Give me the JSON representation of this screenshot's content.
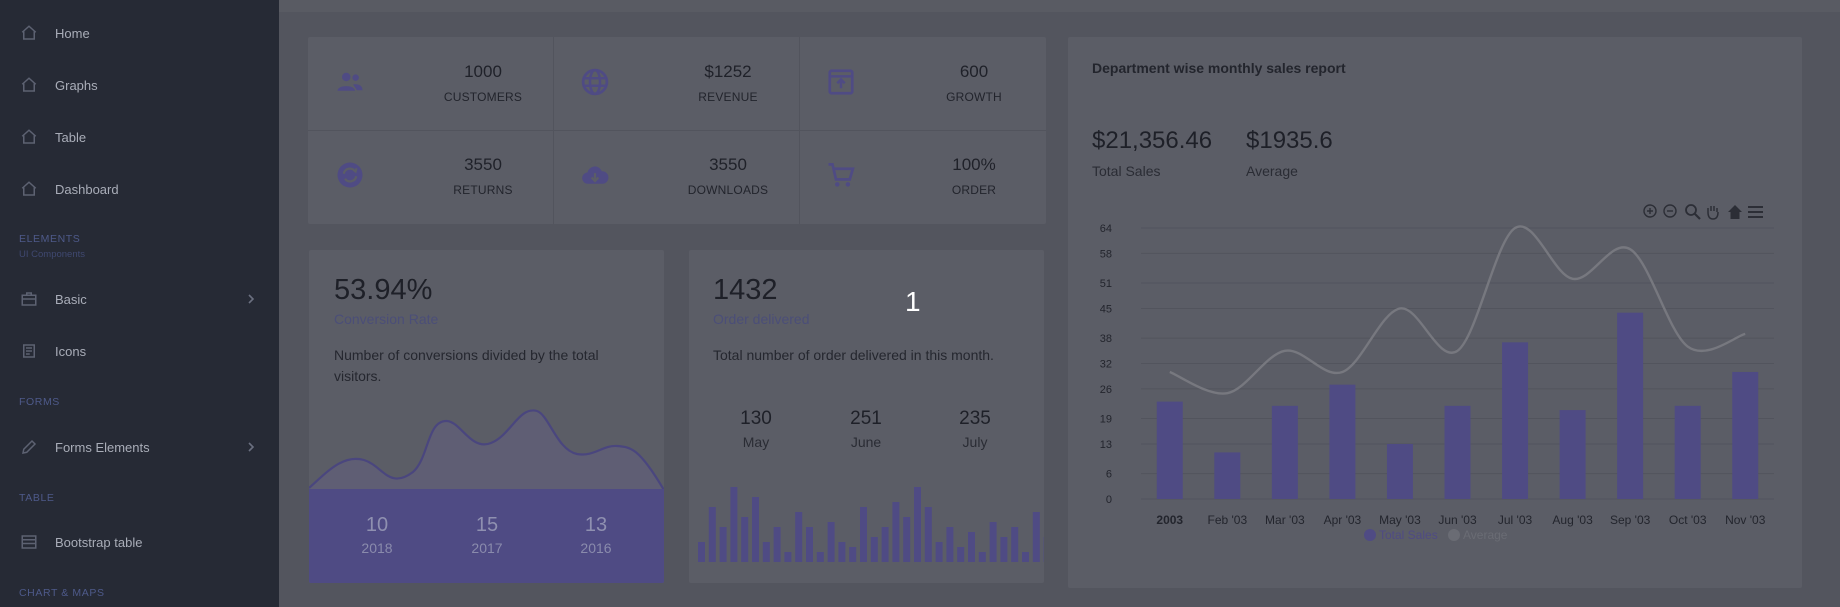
{
  "sidebar": {
    "items": [
      {
        "label": "Home",
        "icon": "home-icon"
      },
      {
        "label": "Graphs",
        "icon": "home-icon"
      },
      {
        "label": "Table",
        "icon": "home-icon"
      },
      {
        "label": "Dashboard",
        "icon": "home-icon"
      }
    ],
    "elements_section": "ELEMENTS",
    "elements_sub": "UI Components",
    "elements_items": [
      {
        "label": "Basic",
        "icon": "briefcase-icon"
      },
      {
        "label": "Icons",
        "icon": "gem-icon"
      }
    ],
    "forms_section": "FORMS",
    "forms_items": [
      {
        "label": "Forms Elements",
        "icon": "pencil-icon"
      }
    ],
    "table_section": "TABLE",
    "table_items": [
      {
        "label": "Bootstrap table",
        "icon": "table-icon"
      }
    ],
    "charts_section": "CHART & MAPS"
  },
  "stats": [
    {
      "value": "1000",
      "label": "CUSTOMERS",
      "icon": "users-icon"
    },
    {
      "value": "$1252",
      "label": "REVENUE",
      "icon": "globe-icon"
    },
    {
      "value": "600",
      "label": "GROWTH",
      "icon": "archive-icon"
    },
    {
      "value": "3550",
      "label": "RETURNS",
      "icon": "sync-icon"
    },
    {
      "value": "3550",
      "label": "DOWNLOADS",
      "icon": "cloud-download-icon"
    },
    {
      "value": "100%",
      "label": "ORDER",
      "icon": "cart-icon"
    }
  ],
  "conversion": {
    "value": "53.94%",
    "label": "Conversion Rate",
    "description": "Number of conversions divided by the total visitors.",
    "years": [
      {
        "value": "10",
        "year": "2018"
      },
      {
        "value": "15",
        "year": "2017"
      },
      {
        "value": "13",
        "year": "2016"
      }
    ]
  },
  "orders": {
    "value": "1432",
    "label": "Order delivered",
    "description": "Total number of order delivered in this month.",
    "months": [
      {
        "value": "130",
        "month": "May"
      },
      {
        "value": "251",
        "month": "June"
      },
      {
        "value": "235",
        "month": "July"
      }
    ],
    "bars": [
      4,
      11,
      7,
      15,
      9,
      13,
      4,
      7,
      2,
      10,
      7,
      2,
      8,
      4,
      3,
      11,
      5,
      7,
      12,
      9,
      15,
      11,
      4,
      7,
      3,
      6,
      2,
      8,
      5,
      7,
      2,
      10,
      5,
      2,
      9,
      5,
      5,
      14
    ]
  },
  "report": {
    "title": "Department wise monthly sales report",
    "total_sales_value": "$21,356.46",
    "total_sales_label": "Total Sales",
    "average_value": "$1935.6",
    "average_label": "Average",
    "toolbar_icons": [
      "zoom-in-icon",
      "zoom-out-icon",
      "search-zoom-icon",
      "pan-hand-icon",
      "home-reset-icon",
      "menu-icon"
    ]
  },
  "chart_data": {
    "type": "bar",
    "categories": [
      "2003",
      "Feb '03",
      "Mar '03",
      "Apr '03",
      "May '03",
      "Jun '03",
      "Jul '03",
      "Aug '03",
      "Sep '03",
      "Oct '03",
      "Nov '03"
    ],
    "series": [
      {
        "name": "Total Sales",
        "type": "bar",
        "color": "#4f4b84",
        "values": [
          23,
          11,
          22,
          27,
          13,
          22,
          37,
          21,
          44,
          22,
          30
        ]
      },
      {
        "name": "Average",
        "type": "line",
        "color": "#77787f",
        "values": [
          30,
          25,
          35,
          30,
          45,
          35,
          64,
          52,
          59,
          36,
          39
        ]
      }
    ],
    "yticks": [
      0,
      6,
      13,
      19,
      26,
      32,
      38,
      45,
      51,
      58,
      64
    ],
    "ylim": [
      0,
      64
    ],
    "grid": true,
    "legend": "bottom-center"
  },
  "overlay": {
    "text": "1"
  },
  "colors": {
    "accent": "#4f4b84",
    "sidebar": "#262a35",
    "card": "#5b5d66"
  }
}
